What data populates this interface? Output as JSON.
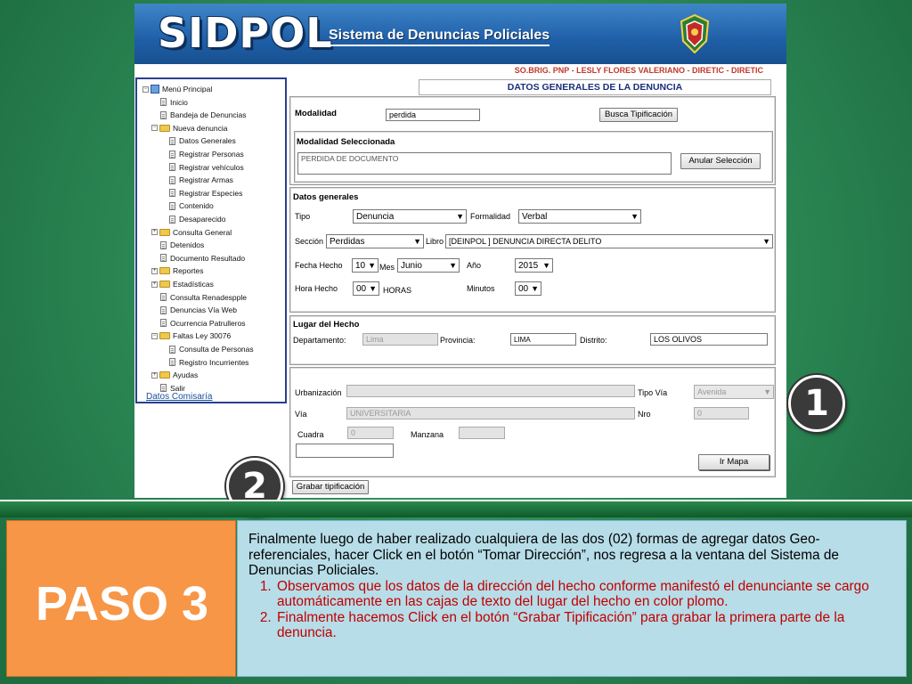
{
  "banner": {
    "logo": "SIDPOL",
    "subtitle": "Sistema de Denuncias Policiales",
    "user": "SO.BRIG. PNP - LESLY FLORES VALERIANO - DIRETIC - DIRETIC"
  },
  "menu": {
    "items": [
      {
        "label": "Menú Principal",
        "icon": "monitor-icon",
        "level": 0,
        "toggle": "−"
      },
      {
        "label": "Inicio",
        "icon": "document-icon",
        "level": 1
      },
      {
        "label": "Bandeja de Denuncias",
        "icon": "document-icon",
        "level": 1
      },
      {
        "label": "Nueva denuncia",
        "icon": "folder-icon",
        "level": 1,
        "toggle": "−"
      },
      {
        "label": "Datos Generales",
        "icon": "document-icon",
        "level": 2
      },
      {
        "label": "Registrar Personas",
        "icon": "document-icon",
        "level": 2
      },
      {
        "label": "Registrar vehículos",
        "icon": "document-icon",
        "level": 2
      },
      {
        "label": "Registrar Armas",
        "icon": "document-icon",
        "level": 2
      },
      {
        "label": "Registrar Especies",
        "icon": "document-icon",
        "level": 2
      },
      {
        "label": "Contenido",
        "icon": "document-icon",
        "level": 2
      },
      {
        "label": "Desaparecido",
        "icon": "document-icon",
        "level": 2
      },
      {
        "label": "Consulta General",
        "icon": "folder-icon",
        "level": 1,
        "toggle": "+"
      },
      {
        "label": "Detenidos",
        "icon": "document-icon",
        "level": 1
      },
      {
        "label": "Documento Resultado",
        "icon": "document-icon",
        "level": 1
      },
      {
        "label": "Reportes",
        "icon": "folder-icon",
        "level": 1,
        "toggle": "+"
      },
      {
        "label": "Estadísticas",
        "icon": "folder-icon",
        "level": 1,
        "toggle": "+"
      },
      {
        "label": "Consulta Renadespple",
        "icon": "document-icon",
        "level": 1
      },
      {
        "label": "Denuncias Vía Web",
        "icon": "document-icon",
        "level": 1
      },
      {
        "label": "Ocurrencia Patrulleros",
        "icon": "document-icon",
        "level": 1
      },
      {
        "label": "Faltas Ley 30076",
        "icon": "folder-icon",
        "level": 1,
        "toggle": "−"
      },
      {
        "label": "Consulta de Personas",
        "icon": "document-icon",
        "level": 2
      },
      {
        "label": "Registro Incurrientes",
        "icon": "document-icon",
        "level": 2
      },
      {
        "label": "Ayudas",
        "icon": "folder-icon",
        "level": 1,
        "toggle": "+"
      },
      {
        "label": "Salir",
        "icon": "document-icon",
        "level": 1
      }
    ],
    "link": "Datos Comisaría"
  },
  "form": {
    "title": "DATOS GENERALES DE LA DENUNCIA",
    "modalidad": {
      "label": "Modalidad",
      "value": "perdida",
      "button": "Busca Tipificación"
    },
    "seleccionada": {
      "label": "Modalidad Seleccionada",
      "value": "PERDIDA DE DOCUMENTO",
      "button": "Anular Selección"
    },
    "generales": {
      "label": "Datos generales",
      "tipo_label": "Tipo",
      "tipo": "Denuncia",
      "formalidad_label": "Formalidad",
      "formalidad": "Verbal",
      "seccion_label": "Sección",
      "seccion": "Perdidas",
      "libro_label": "Libro",
      "libro": "[DEINPOL ] DENUNCIA DIRECTA DELITO",
      "fecha_label": "Fecha Hecho",
      "dia": "10",
      "mes_label": "Mes",
      "mes": "Junio",
      "anio_label": "Año",
      "anio": "2015",
      "hora_label": "Hora Hecho",
      "hora": "00",
      "horas_label": "HORAS",
      "minutos_label": "Minutos",
      "minutos": "00"
    },
    "lugar": {
      "label": "Lugar del Hecho",
      "dep_label": "Departamento:",
      "dep": "Lima",
      "prov_label": "Provincia:",
      "prov": "LIMA",
      "dist_label": "Distrito:",
      "dist": "LOS OLIVOS"
    },
    "direccion": {
      "urb_label": "Urbanización",
      "urb": "",
      "tipo_via_label": "Tipo Vía",
      "tipo_via": "Avenida",
      "via_label": "Vía",
      "via": "UNIVERSITARIA",
      "nro_label": "Nro",
      "nro": "0",
      "cuadra_label": "Cuadra",
      "cuadra": "0",
      "manzana_label": "Manzana",
      "manzana": "",
      "mapa_button": "Ir Mapa"
    },
    "grabar_button": "Grabar tipificación"
  },
  "badges": {
    "one": "1",
    "two": "2"
  },
  "step": {
    "title": "PASO 3",
    "intro": "Finalmente luego de haber realizado cualquiera de las dos (02) formas de agregar datos Geo-referenciales, hacer Click en el botón “Tomar Dirección”, nos regresa a la ventana del Sistema de Denuncias Policiales.",
    "items": [
      "Observamos que los datos de la dirección del hecho conforme manifestó el denunciante se cargo automáticamente en las cajas de texto del lugar del hecho en color plomo.",
      "Finalmente hacemos Click en el botón “Grabar Tipificación” para grabar la primera parte de la denuncia."
    ]
  },
  "colors": {
    "accent": "#f79646",
    "text_box": "#b7dde8",
    "list_text": "#c00000",
    "banner": "#1f5fa8"
  }
}
